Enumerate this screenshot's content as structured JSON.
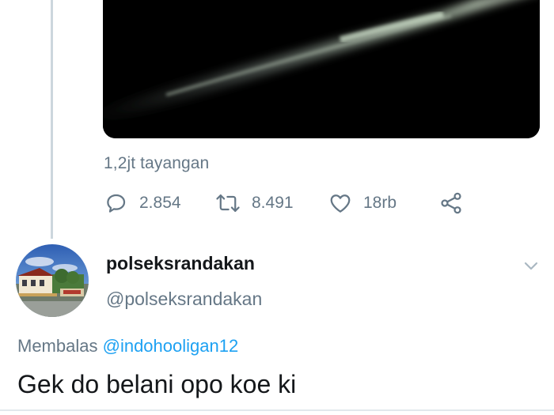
{
  "parent_tweet": {
    "views_text": "1,2jt tayangan",
    "reply_count": "2.854",
    "retweet_count": "8.491",
    "like_count": "18rb"
  },
  "reply_tweet": {
    "display_name": "polseksrandakan",
    "handle": "@polseksrandakan",
    "replying_prefix": "Membalas",
    "replying_to": "@indohooligan12",
    "text": "Gek do belani opo koe ki"
  },
  "icons": {
    "reply": "speech-bubble-icon",
    "retweet": "retweet-icon",
    "like": "heart-icon",
    "share": "share-icon",
    "menu": "chevron-down-icon"
  },
  "colors": {
    "text": "#14171a",
    "secondary": "#657786",
    "link": "#1da1f2",
    "divider": "#e1e8ed"
  }
}
